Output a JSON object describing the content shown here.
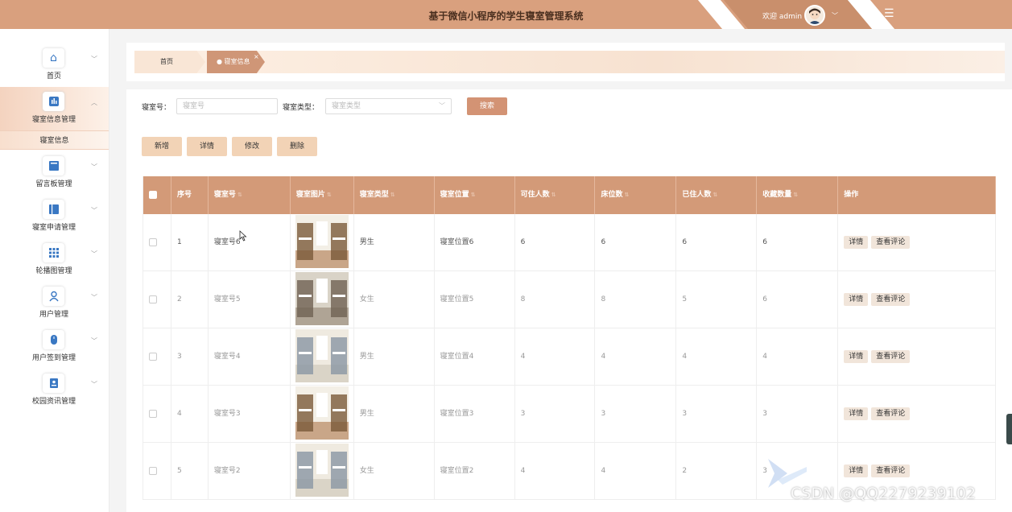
{
  "header": {
    "title": "基于微信小程序的学生寝室管理系统",
    "welcome": "欢迎 admin",
    "colors": {
      "primary": "#d9a07e",
      "accent": "#d39374"
    }
  },
  "sidebar": {
    "items": [
      {
        "label": "首页",
        "icon": "home-icon"
      },
      {
        "label": "寝室信息管理",
        "icon": "bar-chart-icon",
        "active": true,
        "sub": [
          "寝室信息"
        ]
      },
      {
        "label": "留言板管理",
        "icon": "message-board-icon"
      },
      {
        "label": "寝室申请管理",
        "icon": "book-icon"
      },
      {
        "label": "轮播图管理",
        "icon": "grid-icon"
      },
      {
        "label": "用户管理",
        "icon": "user-icon"
      },
      {
        "label": "用户签到管理",
        "icon": "mouse-icon"
      },
      {
        "label": "校园资讯管理",
        "icon": "id-card-icon"
      }
    ]
  },
  "breadcrumb": {
    "home": "首页",
    "current": "● 寝室信息",
    "close": "×"
  },
  "search": {
    "room_no_label": "寝室号：",
    "room_no_placeholder": "寝室号",
    "room_type_label": "寝室类型：",
    "room_type_placeholder": "寝室类型",
    "search_button": "搜索"
  },
  "actions": {
    "add": "新增",
    "detail": "详情",
    "edit": "修改",
    "delete": "删除"
  },
  "table": {
    "columns": [
      "",
      "序号",
      "寝室号",
      "寝室图片",
      "寝室类型",
      "寝室位置",
      "可住人数",
      "床位数",
      "已住人数",
      "收藏数量",
      "操作"
    ],
    "row_actions": {
      "detail": "详情",
      "comments": "查看评论"
    },
    "rows": [
      {
        "index": "1",
        "room": "寝室号6",
        "type": "男生",
        "location": "寝室位置6",
        "capacity": "6",
        "beds": "6",
        "occupied": "6",
        "favorites": "6"
      },
      {
        "index": "2",
        "room": "寝室号5",
        "type": "女生",
        "location": "寝室位置5",
        "capacity": "8",
        "beds": "8",
        "occupied": "5",
        "favorites": "6"
      },
      {
        "index": "3",
        "room": "寝室号4",
        "type": "男生",
        "location": "寝室位置4",
        "capacity": "4",
        "beds": "4",
        "occupied": "4",
        "favorites": "4"
      },
      {
        "index": "4",
        "room": "寝室号3",
        "type": "男生",
        "location": "寝室位置3",
        "capacity": "3",
        "beds": "3",
        "occupied": "3",
        "favorites": "3"
      },
      {
        "index": "5",
        "room": "寝室号2",
        "type": "女生",
        "location": "寝室位置2",
        "capacity": "4",
        "beds": "4",
        "occupied": "2",
        "favorites": "3"
      }
    ]
  },
  "watermark": "CSDN @QQ2279239102"
}
